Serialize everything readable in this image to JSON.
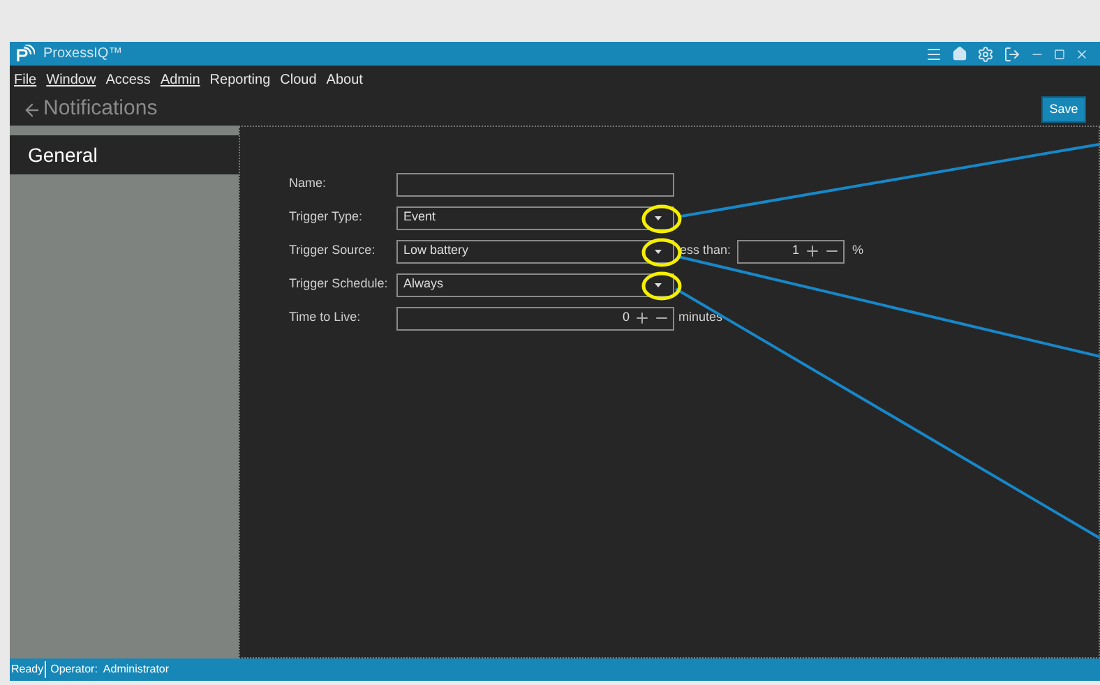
{
  "window": {
    "title": "ProxessIQ™"
  },
  "menu": [
    {
      "label": "File",
      "mnemonic": true
    },
    {
      "label": "Window",
      "mnemonic": true
    },
    {
      "label": "Access",
      "mnemonic": false
    },
    {
      "label": "Admin",
      "mnemonic": true
    },
    {
      "label": "Reporting",
      "mnemonic": false
    },
    {
      "label": "Cloud",
      "mnemonic": false
    },
    {
      "label": "About",
      "mnemonic": false
    }
  ],
  "page": {
    "title": "Notifications",
    "save": "Save"
  },
  "sidebar": {
    "items": [
      {
        "label": "General",
        "selected": true
      }
    ]
  },
  "form": [
    {
      "kind": "text",
      "label": "Name:"
    },
    {
      "kind": "dropdown",
      "label": "Trigger Type:",
      "value": "Event"
    },
    {
      "kind": "dropdown",
      "label": "Trigger Source:",
      "value": "Low battery",
      "extra": {
        "label": "ess than:",
        "value": "1",
        "unit": "%"
      }
    },
    {
      "kind": "dropdown",
      "label": "Trigger Schedule:",
      "value": "Always"
    },
    {
      "kind": "number",
      "label": "Time to Live:",
      "value": "0",
      "unit": "minutes"
    }
  ],
  "status_bar": {
    "state": "Ready",
    "operator": "Operator:  Administrator"
  }
}
